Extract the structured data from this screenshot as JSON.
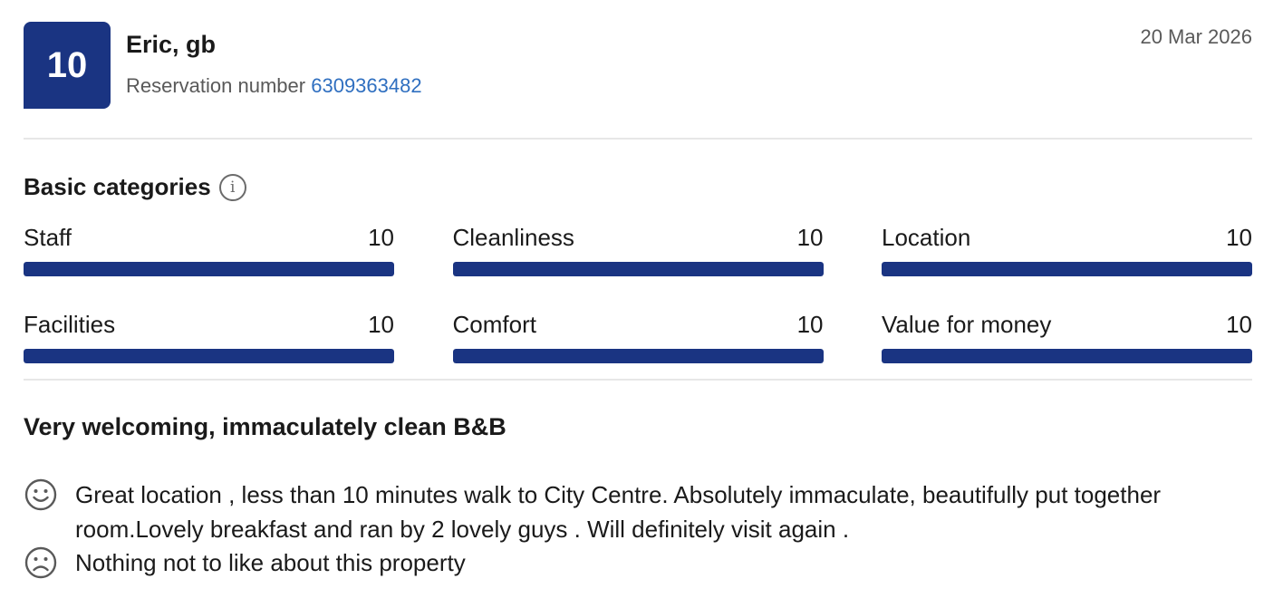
{
  "review": {
    "score": "10",
    "reviewer": "Eric, gb",
    "reservation_label": "Reservation number",
    "reservation_number": "6309363482",
    "date": "20 Mar 2026",
    "categories_heading": "Basic categories",
    "categories": [
      {
        "name": "Staff",
        "score": "10",
        "fill": 1.0
      },
      {
        "name": "Cleanliness",
        "score": "10",
        "fill": 1.0
      },
      {
        "name": "Location",
        "score": "10",
        "fill": 1.0
      },
      {
        "name": "Facilities",
        "score": "10",
        "fill": 1.0
      },
      {
        "name": "Comfort",
        "score": "10",
        "fill": 1.0
      },
      {
        "name": "Value for money",
        "score": "10",
        "fill": 1.0
      }
    ],
    "title": "Very welcoming, immaculately clean B&B",
    "positive": "Great location , less than 10 minutes walk to City Centre. Absolutely immaculate, beautifully put together room.Lovely breakfast and ran by 2 lovely guys . Will definitely visit again .",
    "negative": "Nothing not to like about this property"
  },
  "icons": {
    "info": "info-icon",
    "positive": "smiley-face-icon",
    "negative": "frowning-face-icon"
  },
  "colors": {
    "brand": "#1a3482",
    "link": "#2f6fc0"
  }
}
